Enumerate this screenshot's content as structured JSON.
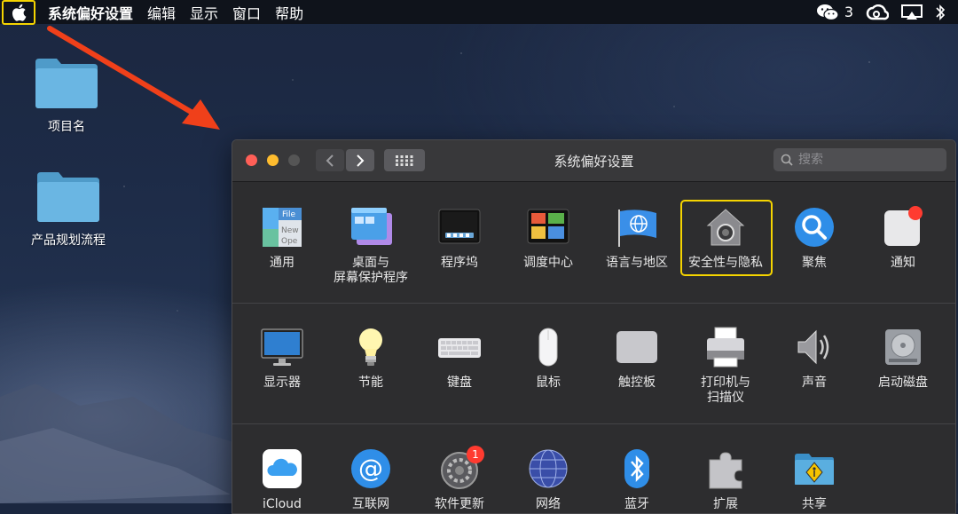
{
  "menubar": {
    "app_name": "系统偏好设置",
    "items": [
      "编辑",
      "显示",
      "窗口",
      "帮助"
    ],
    "wechat_count": "3"
  },
  "desktop": {
    "icons": [
      {
        "label": "项目名"
      },
      {
        "label": "产品规划流程"
      }
    ]
  },
  "window": {
    "title": "系统偏好设置",
    "search_placeholder": "搜索",
    "rows": [
      [
        {
          "label": "通用",
          "icon": "general-icon"
        },
        {
          "label": "桌面与",
          "label2": "屏幕保护程序",
          "icon": "desktop-screensaver-icon"
        },
        {
          "label": "程序坞",
          "icon": "dock-icon"
        },
        {
          "label": "调度中心",
          "icon": "mission-control-icon"
        },
        {
          "label": "语言与地区",
          "icon": "language-region-icon"
        },
        {
          "label": "安全性与隐私",
          "icon": "security-privacy-icon"
        },
        {
          "label": "聚焦",
          "icon": "spotlight-icon"
        },
        {
          "label": "通知",
          "icon": "notifications-icon"
        }
      ],
      [
        {
          "label": "显示器",
          "icon": "displays-icon"
        },
        {
          "label": "节能",
          "icon": "energy-saver-icon"
        },
        {
          "label": "键盘",
          "icon": "keyboard-icon"
        },
        {
          "label": "鼠标",
          "icon": "mouse-icon"
        },
        {
          "label": "触控板",
          "icon": "trackpad-icon"
        },
        {
          "label": "打印机与",
          "label2": "扫描仪",
          "icon": "printer-scanner-icon"
        },
        {
          "label": "声音",
          "icon": "sound-icon"
        },
        {
          "label": "启动磁盘",
          "icon": "startup-disk-icon"
        }
      ],
      [
        {
          "label": "iCloud",
          "icon": "icloud-icon"
        },
        {
          "label": "互联网",
          "icon": "internet-accounts-icon"
        },
        {
          "label": "软件更新",
          "icon": "software-update-icon",
          "badge": "1"
        },
        {
          "label": "网络",
          "icon": "network-icon"
        },
        {
          "label": "蓝牙",
          "icon": "bluetooth-icon"
        },
        {
          "label": "扩展",
          "icon": "extensions-icon"
        },
        {
          "label": "共享",
          "icon": "sharing-icon"
        }
      ]
    ]
  },
  "colors": {
    "highlight": "#f5d400",
    "arrow": "#f0401a"
  }
}
